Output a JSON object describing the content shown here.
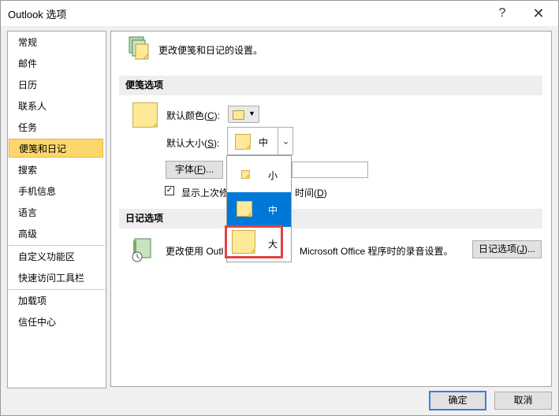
{
  "window": {
    "title": "Outlook 选项",
    "help_label": "?",
    "close_label": "✕"
  },
  "sidebar": {
    "items": [
      {
        "label": "常规"
      },
      {
        "label": "邮件"
      },
      {
        "label": "日历"
      },
      {
        "label": "联系人"
      },
      {
        "label": "任务"
      },
      {
        "label": "便笺和日记"
      },
      {
        "label": "搜索"
      },
      {
        "label": "手机信息"
      },
      {
        "label": "语言"
      },
      {
        "label": "高级"
      },
      {
        "label": "自定义功能区"
      },
      {
        "label": "快速访问工具栏"
      },
      {
        "label": "加载项"
      },
      {
        "label": "信任中心"
      }
    ],
    "selected": "便笺和日记"
  },
  "header": {
    "description": "更改便笺和日记的设置。"
  },
  "notes_section": {
    "title": "便笺选项",
    "color_label": "默认颜色(",
    "color_key": "C",
    "color_suffix": "):",
    "size_label": "默认大小(",
    "size_key": "S",
    "size_suffix": "):",
    "size_value": "中",
    "font_button": "字体(",
    "font_key": "F",
    "font_suffix": ")...",
    "show_time_label_a": "显示上次修",
    "show_time_label_b": "时间(",
    "show_time_key": "D",
    "show_time_suffix": ")",
    "show_time_checked": true
  },
  "size_dropdown": {
    "options": [
      "小",
      "中",
      "大"
    ],
    "selected": "中",
    "highlighted": "大"
  },
  "journal_section": {
    "title": "日记选项",
    "description_a": "更改使用 Outl",
    "description_b": "Microsoft Office 程序时的录音设置。",
    "button_label": "日记选项(",
    "button_key": "J",
    "button_suffix": ")..."
  },
  "footer": {
    "ok": "确定",
    "cancel": "取消"
  },
  "colors": {
    "selected_sidebar": "#fbd76c",
    "note_yellow": "#fde997",
    "dropdown_selected": "#0078d7",
    "highlight_box": "#e04343"
  }
}
